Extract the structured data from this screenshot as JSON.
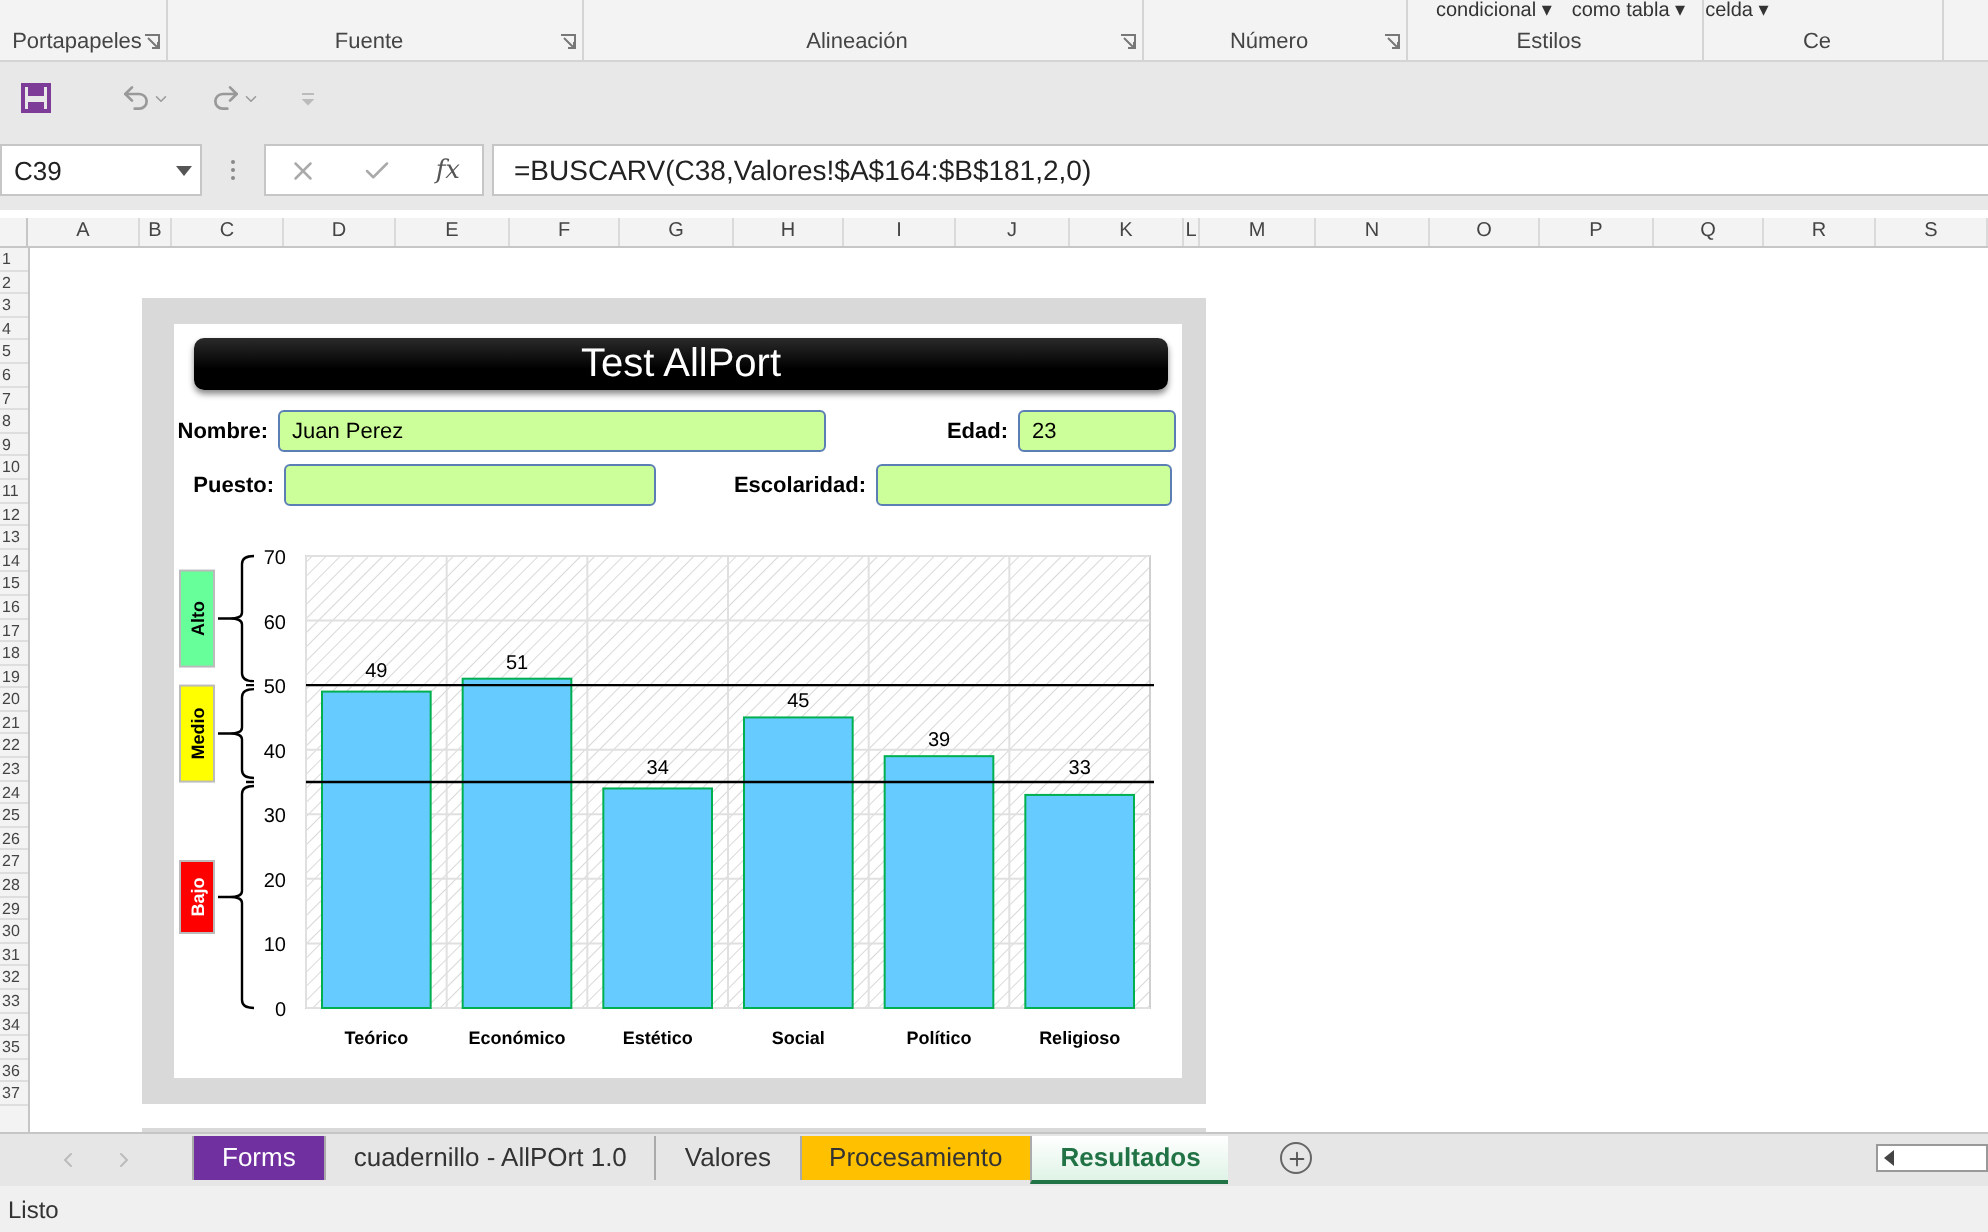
{
  "ribbon": {
    "top_items": [
      "condicional ▾",
      "como tabla ▾",
      "celda ▾"
    ],
    "groups": [
      {
        "label": "Portapapeles",
        "launcher": true
      },
      {
        "label": "Fuente",
        "launcher": true
      },
      {
        "label": "Alineación",
        "launcher": true
      },
      {
        "label": "Número",
        "launcher": true
      },
      {
        "label": "Estilos",
        "launcher": false
      },
      {
        "label": "Ce",
        "launcher": false
      }
    ]
  },
  "formula_bar": {
    "name_box": "C39",
    "fx": "fx",
    "formula": "=BUSCARV(C38,Valores!$A$164:$B$181,2,0)"
  },
  "columns": [
    "A",
    "B",
    "C",
    "D",
    "E",
    "F",
    "G",
    "H",
    "I",
    "J",
    "K",
    "L",
    "M",
    "N",
    "O",
    "P",
    "Q",
    "R",
    "S"
  ],
  "rows": [
    "1",
    "2",
    "3",
    "4",
    "5",
    "6",
    "7",
    "8",
    "9",
    "10",
    "11",
    "12",
    "13",
    "14",
    "15",
    "16",
    "17",
    "18",
    "19",
    "20",
    "21",
    "22",
    "23",
    "24",
    "25",
    "26",
    "27",
    "28",
    "29",
    "30",
    "31",
    "32",
    "33",
    "34",
    "35",
    "36",
    "37"
  ],
  "report": {
    "title": "Test AllPort",
    "fields": [
      {
        "label": "Nombre:",
        "value": "Juan Perez"
      },
      {
        "label": "Edad:",
        "value": "23"
      },
      {
        "label": "Puesto:"
      },
      {
        "label": "Escolaridad:"
      }
    ],
    "levels": [
      {
        "label": "Alto",
        "color": "#66ff99"
      },
      {
        "label": "Medio",
        "color": "#ffff00"
      },
      {
        "label": "Bajo",
        "color": "#ff0000"
      }
    ],
    "chart_data": {
      "type": "bar",
      "categories": [
        "Teórico",
        "Económico",
        "Estético",
        "Social",
        "Político",
        "Religioso"
      ],
      "values": [
        49,
        51,
        34,
        45,
        39,
        33
      ],
      "ylim": [
        0,
        70
      ],
      "yticks": [
        0,
        10,
        20,
        30,
        40,
        50,
        60,
        70
      ],
      "data_labels": true,
      "grid": true,
      "ref_lines": [
        {
          "axis": "y",
          "value": 50
        },
        {
          "axis": "y",
          "value": 35
        }
      ]
    }
  },
  "sheet_tabs": [
    {
      "label": "Forms",
      "selected": false,
      "color": "#7030a0"
    },
    {
      "label": "cuadernillo - AllPOrt 1.0",
      "selected": false
    },
    {
      "label": "Valores",
      "selected": false
    },
    {
      "label": "Procesamiento",
      "selected": false,
      "color": "#ffc000"
    },
    {
      "label": "Resultados",
      "selected": true
    }
  ],
  "status_bar": {
    "text": "Listo"
  }
}
